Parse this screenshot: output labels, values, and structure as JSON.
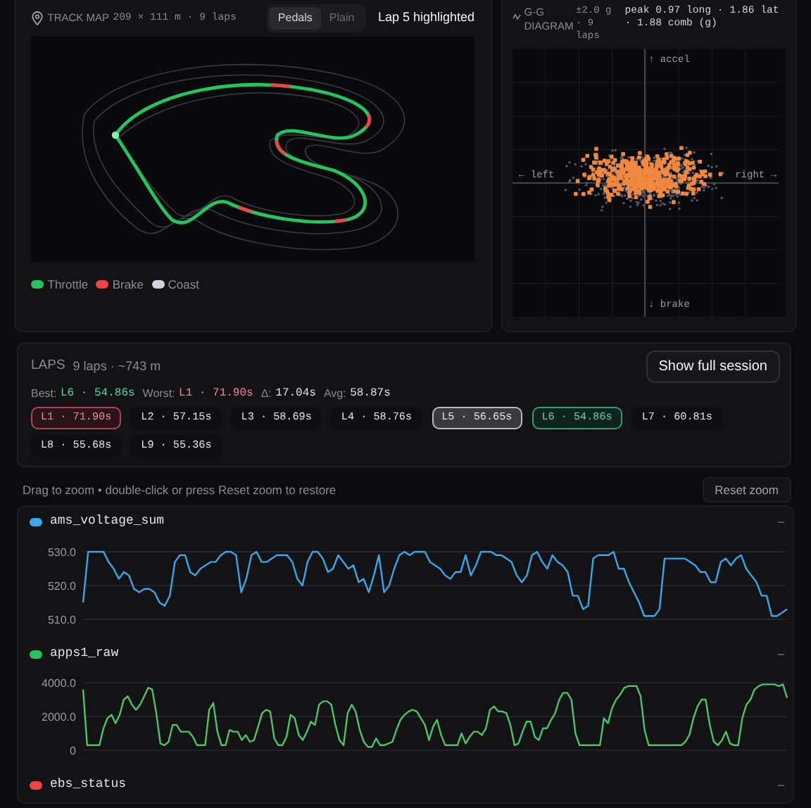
{
  "track_map": {
    "title": "TRACK MAP",
    "meta": "209 × 111 m · 9 laps",
    "modes": [
      {
        "label": "Pedals",
        "selected": true
      },
      {
        "label": "Plain",
        "selected": false
      }
    ],
    "highlight": "Lap 5 highlighted",
    "legend": [
      {
        "label": "Throttle",
        "color": "#22c55e"
      },
      {
        "label": "Brake",
        "color": "#ef4444"
      },
      {
        "label": "Coast",
        "color": "#cbd5e1"
      }
    ]
  },
  "gg_diagram": {
    "title": "G-G DIAGRAM",
    "range": "±2.0 g · 9 laps",
    "peak": "peak 0.97 long · 1.86 lat · 1.88 comb (g)",
    "axes": {
      "up": "↑ accel",
      "left": "← left",
      "right": "right →",
      "down": "↓ brake"
    }
  },
  "laps": {
    "title": "LAPS",
    "meta": "9 laps · ~743 m",
    "action": "Show full session",
    "summary": [
      {
        "label": "Best:",
        "value": "L6 · 54.86s",
        "kind": "best"
      },
      {
        "label": "Worst:",
        "value": "L1 · 71.90s",
        "kind": "worst"
      },
      {
        "label": "Δ:",
        "value": "17.04s",
        "kind": "plain"
      },
      {
        "label": "Avg:",
        "value": "58.87s",
        "kind": "plain"
      }
    ],
    "chips": [
      {
        "label": "L1 · 71.90s",
        "kind": "worst",
        "selected": false
      },
      {
        "label": "L2 · 57.15s",
        "kind": "normal",
        "selected": false
      },
      {
        "label": "L3 · 58.69s",
        "kind": "normal",
        "selected": false
      },
      {
        "label": "L4 · 58.76s",
        "kind": "normal",
        "selected": false
      },
      {
        "label": "L5 · 56.65s",
        "kind": "normal",
        "selected": true
      },
      {
        "label": "L6 · 54.86s",
        "kind": "best",
        "selected": false
      },
      {
        "label": "L7 · 60.81s",
        "kind": "normal",
        "selected": false
      },
      {
        "label": "L8 · 55.68s",
        "kind": "normal",
        "selected": false
      },
      {
        "label": "L9 · 55.36s",
        "kind": "normal",
        "selected": false
      }
    ]
  },
  "zoom_hint": "Drag to zoom • double-click or press Reset zoom to restore",
  "reset_zoom": "Reset zoom",
  "channels": [
    {
      "name": "ams_voltage_sum",
      "color": "#38a8e8",
      "collapse": "–",
      "chart_data": {
        "type": "line",
        "grid": true,
        "ylim": [
          510,
          530
        ],
        "yticks": [
          {
            "value": 510,
            "label": "510.0"
          },
          {
            "value": 520,
            "label": "520.0"
          },
          {
            "value": 530,
            "label": "530.0"
          }
        ],
        "series": [
          {
            "color": "#38a8e8",
            "values": [
              515,
              530,
              530,
              530,
              530,
              527,
              525,
              522,
              524,
              523,
              519,
              518,
              519,
              519,
              518,
              515,
              514,
              517,
              527,
              529,
              529,
              524,
              523,
              525,
              526,
              527,
              527,
              529,
              530,
              530,
              529,
              518,
              522,
              529,
              530,
              527,
              527,
              528,
              529,
              529,
              529,
              527,
              522,
              520,
              527,
              530,
              530,
              528,
              524,
              525,
              529,
              527,
              525,
              526,
              521,
              522,
              518,
              523,
              529,
              518,
              520,
              525,
              529,
              530,
              529,
              530,
              530,
              530,
              527,
              526,
              525,
              523,
              522,
              524,
              524,
              529,
              523,
              526,
              530,
              530,
              530,
              529,
              529,
              528,
              527,
              523,
              521,
              523,
              529,
              530,
              527,
              525,
              529,
              527,
              526,
              524,
              517,
              517,
              513,
              514,
              528,
              529,
              529,
              529,
              530,
              525,
              525,
              521,
              518,
              515,
              511,
              511,
              511,
              513,
              528,
              528,
              528,
              528,
              528,
              527,
              526,
              524,
              524,
              521,
              521,
              527,
              528,
              526,
              528,
              529,
              525,
              523,
              521,
              517,
              517,
              511,
              511,
              512,
              513
            ]
          }
        ]
      }
    },
    {
      "name": "apps1_raw",
      "color": "#22c55e",
      "collapse": "–",
      "chart_data": {
        "type": "line",
        "grid": true,
        "ylim": [
          0,
          4000
        ],
        "yticks": [
          {
            "value": 0,
            "label": "0"
          },
          {
            "value": 2000,
            "label": "2000.0"
          },
          {
            "value": 4000,
            "label": "4000.0"
          }
        ],
        "series": [
          {
            "color": "#4cc46a",
            "values": [
              3600,
              300,
              300,
              300,
              300,
              1300,
              1900,
              2100,
              1600,
              2100,
              3000,
              3200,
              2700,
              2400,
              2700,
              3200,
              3700,
              3600,
              2200,
              400,
              300,
              500,
              1500,
              1500,
              1100,
              1100,
              1100,
              800,
              300,
              300,
              300,
              2400,
              2800,
              1100,
              300,
              300,
              1200,
              1100,
              1100,
              600,
              900,
              500,
              600,
              1400,
              2200,
              2400,
              2300,
              700,
              300,
              300,
              800,
              2100,
              1900,
              900,
              600,
              1100,
              1700,
              1500,
              2700,
              2900,
              2900,
              2700,
              1500,
              600,
              300,
              2200,
              2700,
              2300,
              1200,
              500,
              200,
              200,
              700,
              300,
              300,
              400,
              500,
              1200,
              1800,
              2100,
              2300,
              2400,
              2300,
              1900,
              1500,
              600,
              1400,
              1800,
              900,
              300,
              300,
              300,
              300,
              1000,
              400,
              800,
              1100,
              1100,
              900,
              1300,
              2400,
              2600,
              2300,
              2300,
              2200,
              1500,
              300,
              400,
              1100,
              1700,
              1700,
              800,
              600,
              1300,
              1300,
              1800,
              2200,
              3000,
              3400,
              3400,
              3000,
              1000,
              300,
              300,
              300,
              300,
              300,
              300,
              1900,
              1600,
              2500,
              3000,
              3300,
              3700,
              3800,
              3800,
              3800,
              3200,
              1200,
              300,
              300,
              300,
              300,
              300,
              300,
              300,
              300,
              300,
              500,
              900,
              1900,
              2600,
              3000,
              3000,
              1500,
              500,
              300,
              600,
              1100,
              400,
              300,
              300,
              1900,
              2700,
              3000,
              3600,
              3800,
              3900,
              3900,
              3900,
              3900,
              3800,
              3900,
              3100
            ]
          }
        ]
      }
    },
    {
      "name": "ebs_status",
      "color": "#ef4444",
      "collapse": "–"
    }
  ]
}
